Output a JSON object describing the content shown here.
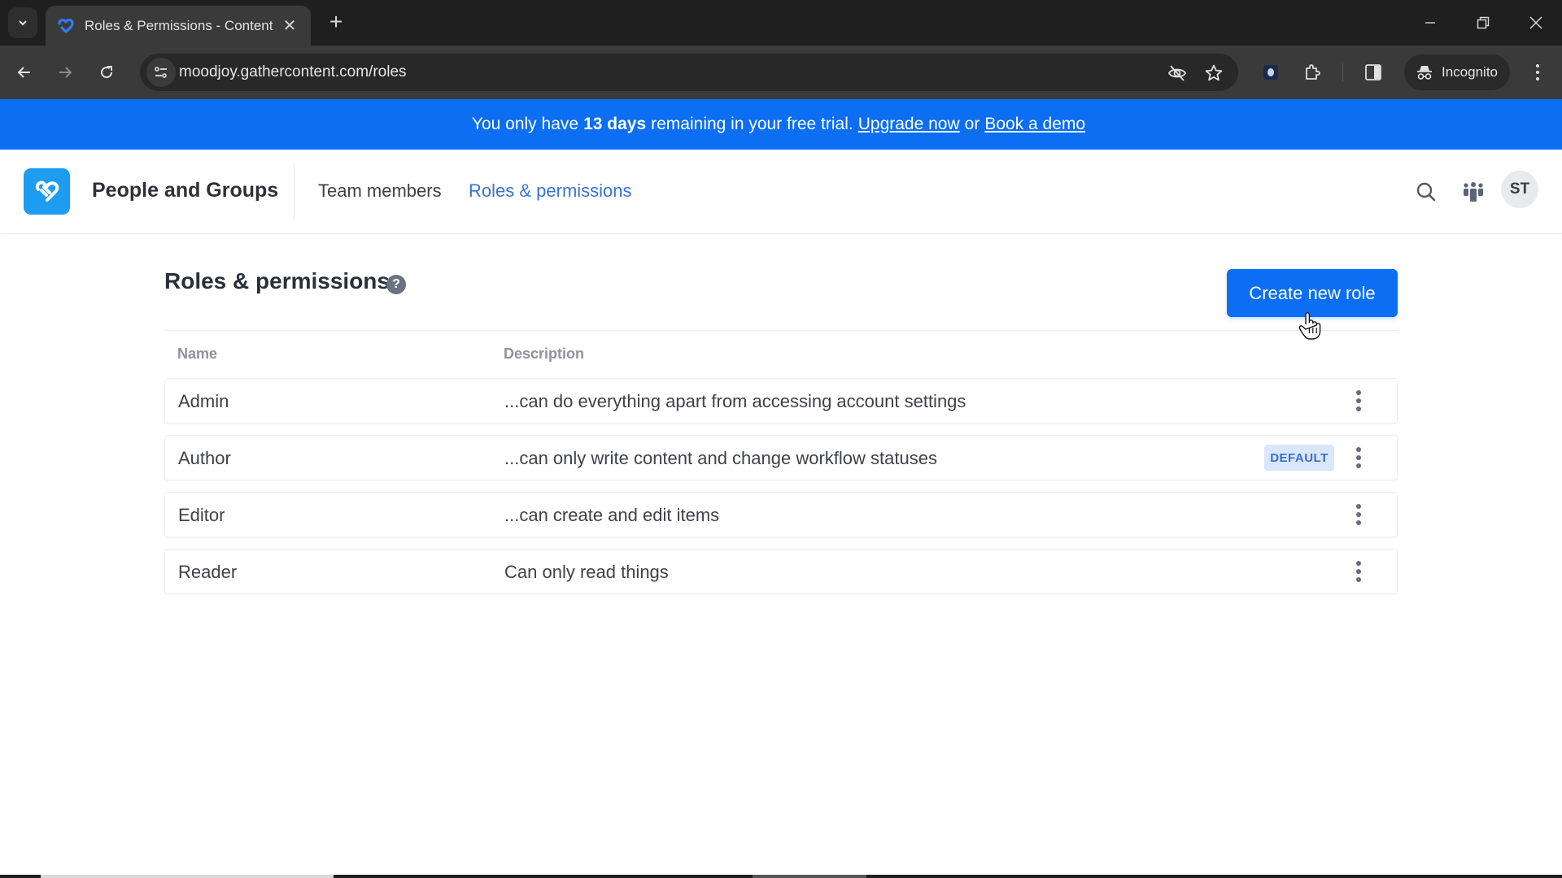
{
  "browser": {
    "tab_title": "Roles & Permissions - Content",
    "url": "moodjoy.gathercontent.com/roles",
    "incognito_label": "Incognito"
  },
  "banner": {
    "text_before": "You only have",
    "days": "13 days",
    "text_after": "remaining in your free trial.",
    "upgrade_link": "Upgrade now",
    "or": "or",
    "demo_link": "Book a demo",
    "color": "#0b6ef3"
  },
  "header": {
    "app_title": "People and Groups",
    "tabs": [
      {
        "label": "Team members",
        "active": false
      },
      {
        "label": "Roles & permissions",
        "active": true
      }
    ],
    "avatar_initials": "ST",
    "accent_color": "#3a73d0"
  },
  "main": {
    "title": "Roles & permissions",
    "help_icon_glyph": "?",
    "create_button": "Create new role",
    "columns": {
      "name": "Name",
      "description": "Description"
    },
    "roles": [
      {
        "name": "Admin",
        "description": "...can do everything apart from accessing account settings",
        "badge": ""
      },
      {
        "name": "Author",
        "description": "...can only write content and change workflow statuses",
        "badge": "DEFAULT"
      },
      {
        "name": "Editor",
        "description": "...can create and edit items",
        "badge": ""
      },
      {
        "name": "Reader",
        "description": "Can only read things",
        "badge": ""
      }
    ]
  }
}
